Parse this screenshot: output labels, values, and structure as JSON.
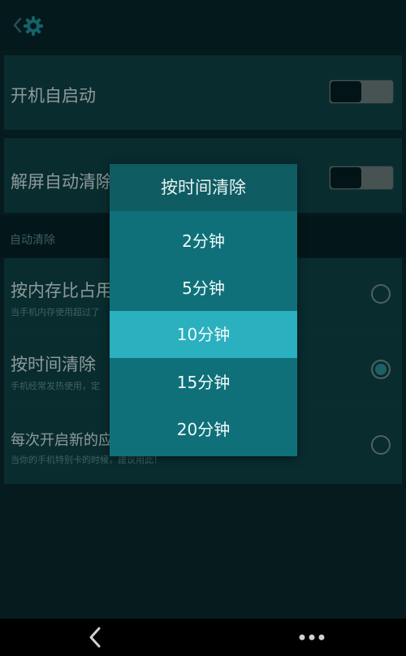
{
  "settings": {
    "auto_start": {
      "title": "开机自启动",
      "enabled": false
    },
    "unlock_clean": {
      "title": "解屏自动清除",
      "enabled": false
    },
    "section_auto_clean": "自动清除",
    "options": [
      {
        "title": "按内存比占用",
        "subtitle": "当手机内存使用超过了",
        "selected": false
      },
      {
        "title": "按时间清除",
        "subtitle": "手机经常发热使用，定",
        "selected": true
      },
      {
        "title": "每次开启新的应",
        "subtitle": "当你的手机特别卡的时候，建议用此！",
        "selected": false
      }
    ]
  },
  "dialog": {
    "title": "按时间清除",
    "options": [
      "2分钟",
      "5分钟",
      "10分钟",
      "15分钟",
      "20分钟"
    ],
    "selected_index": 2
  },
  "colors": {
    "background": "#0a2326",
    "card": "#0f3d40",
    "dialog": "#0f7079",
    "dialog_title_bar": "#0e5c62",
    "dialog_selected": "#2ab0be",
    "accent_radio": "#2b8b95"
  },
  "icons": {
    "header_back": "chevron-left-icon",
    "header_settings": "gear-icon",
    "nav_back": "chevron-left-icon",
    "nav_menu": "more-horizontal-icon"
  }
}
